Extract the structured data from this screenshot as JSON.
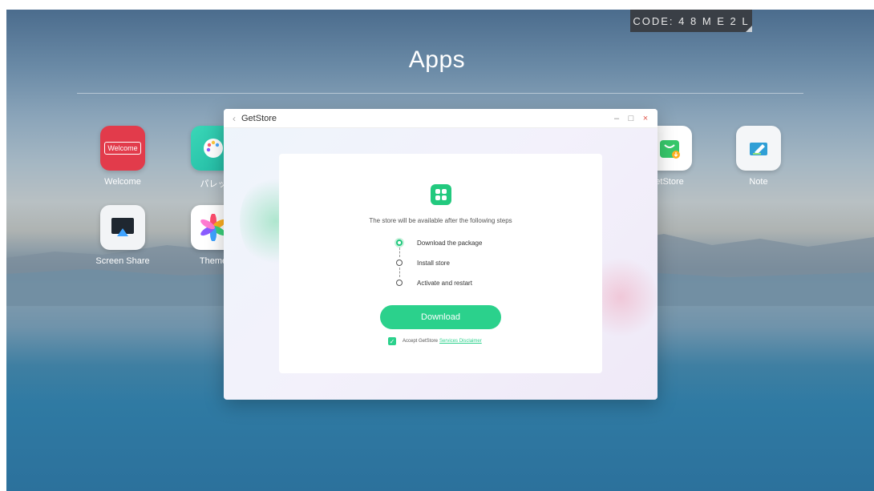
{
  "header": {
    "code_badge": "CODE: 4 8 M E 2 L",
    "title": "Apps"
  },
  "apps": [
    {
      "label": "Welcome",
      "icon": "welcome-icon",
      "icon_text": "Welcome"
    },
    {
      "label": "パレッ",
      "icon": "palette-icon"
    },
    {
      "label": "etStore",
      "icon": "getstore-icon"
    },
    {
      "label": "Note",
      "icon": "note-icon"
    },
    {
      "label": "Screen Share",
      "icon": "screen-share-icon"
    },
    {
      "label": "Theme",
      "icon": "theme-icon"
    }
  ],
  "modal": {
    "title": "GetStore",
    "back_glyph": "‹",
    "minimize_glyph": "–",
    "maximize_glyph": "□",
    "close_glyph": "×",
    "intro": "The store will be available after the following steps",
    "steps": [
      {
        "label": "Download the package",
        "active": true
      },
      {
        "label": "Install store",
        "active": false
      },
      {
        "label": "Activate and restart",
        "active": false
      }
    ],
    "download_label": "Download",
    "accept_text": "Accept GetStore",
    "disclaimer_link": "Services Disclaimer",
    "accept_checked": true
  },
  "colors": {
    "accent": "#2bd18c",
    "badge_bg": "#3a3f46"
  }
}
